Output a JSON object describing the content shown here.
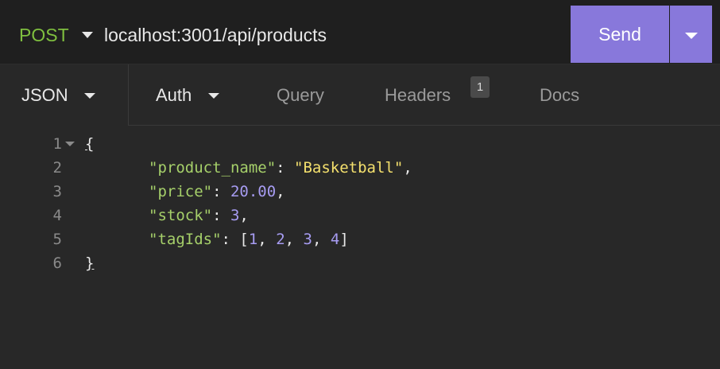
{
  "request": {
    "method": "POST",
    "url": "localhost:3001/api/products",
    "send_label": "Send"
  },
  "tabs": {
    "body_label": "JSON",
    "auth_label": "Auth",
    "query_label": "Query",
    "headers_label": "Headers",
    "headers_count": "1",
    "docs_label": "Docs"
  },
  "editor": {
    "line_numbers": [
      "1",
      "2",
      "3",
      "4",
      "5",
      "6"
    ],
    "open_brace": "{",
    "close_brace": "}",
    "fields": [
      {
        "key": "\"product_name\"",
        "value": "\"Basketball\"",
        "type": "string",
        "trail": ","
      },
      {
        "key": "\"price\"",
        "value": "20.00",
        "type": "number",
        "trail": ","
      },
      {
        "key": "\"stock\"",
        "value": "3",
        "type": "number",
        "trail": ","
      },
      {
        "key": "\"tagIds\"",
        "type": "array",
        "items": [
          "1",
          "2",
          "3",
          "4"
        ],
        "trail": ""
      }
    ]
  },
  "colors": {
    "method": "#7fbf3f",
    "send_button": "#8878db",
    "json_key": "#a6d06a",
    "json_string": "#f4e06d",
    "json_number": "#a79cf2"
  }
}
